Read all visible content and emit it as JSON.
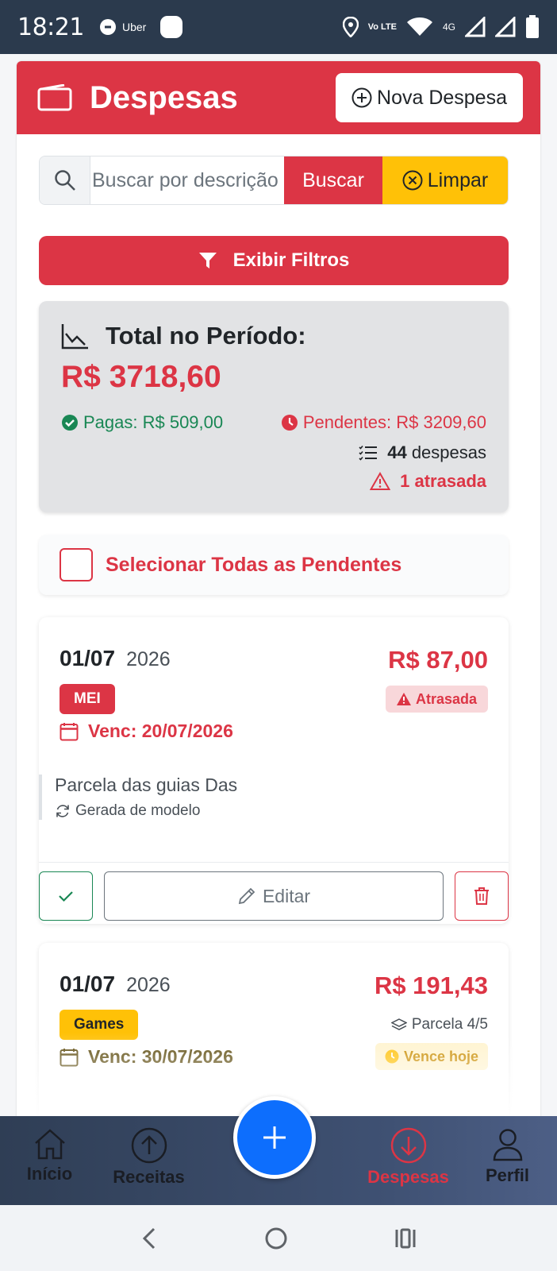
{
  "status_bar": {
    "time": "18:21",
    "app_label": "Uber",
    "network_lte": "Vo LTE",
    "network_4g": "4G"
  },
  "header": {
    "title": "Despesas",
    "new_button": "Nova Despesa",
    "icon": "wallet-icon"
  },
  "search": {
    "placeholder": "Buscar por descrição",
    "search_button": "Buscar",
    "clear_button": "Limpar"
  },
  "filters_button": "Exibir Filtros",
  "summary": {
    "title": "Total no Período:",
    "total": "R$ 3718,60",
    "paid": "Pagas: R$ 509,00",
    "pending": "Pendentes: R$ 3209,60",
    "count_number": "44",
    "count_label": "despesas",
    "late": "1 atrasada"
  },
  "select_all_label": "Selecionar Todas as Pendentes",
  "expenses": [
    {
      "date": "01/07",
      "year": "2026",
      "amount": "R$ 87,00",
      "category": "MEI",
      "due": "Venc: 20/07/2026",
      "status": "Atrasada",
      "description": "Parcela das guias Das",
      "origin": "Gerada de modelo",
      "edit_label": "Editar"
    },
    {
      "date": "01/07",
      "year": "2026",
      "amount": "R$ 191,43",
      "category": "Games",
      "installment": "Parcela 4/5",
      "due": "Venc: 30/07/2026",
      "status": "Vence hoje"
    }
  ],
  "bottom_nav": {
    "items": [
      {
        "label": "Início",
        "icon": "home-icon"
      },
      {
        "label": "Receitas",
        "icon": "arrow-up-circle-icon"
      },
      {
        "label": "Despesas",
        "icon": "arrow-down-circle-icon",
        "active": true
      },
      {
        "label": "Perfil",
        "icon": "person-icon"
      }
    ],
    "fab_icon": "plus-icon"
  },
  "colors": {
    "danger": "#dc3545",
    "warning": "#ffc107",
    "success": "#198754",
    "primary": "#0d6efd"
  }
}
